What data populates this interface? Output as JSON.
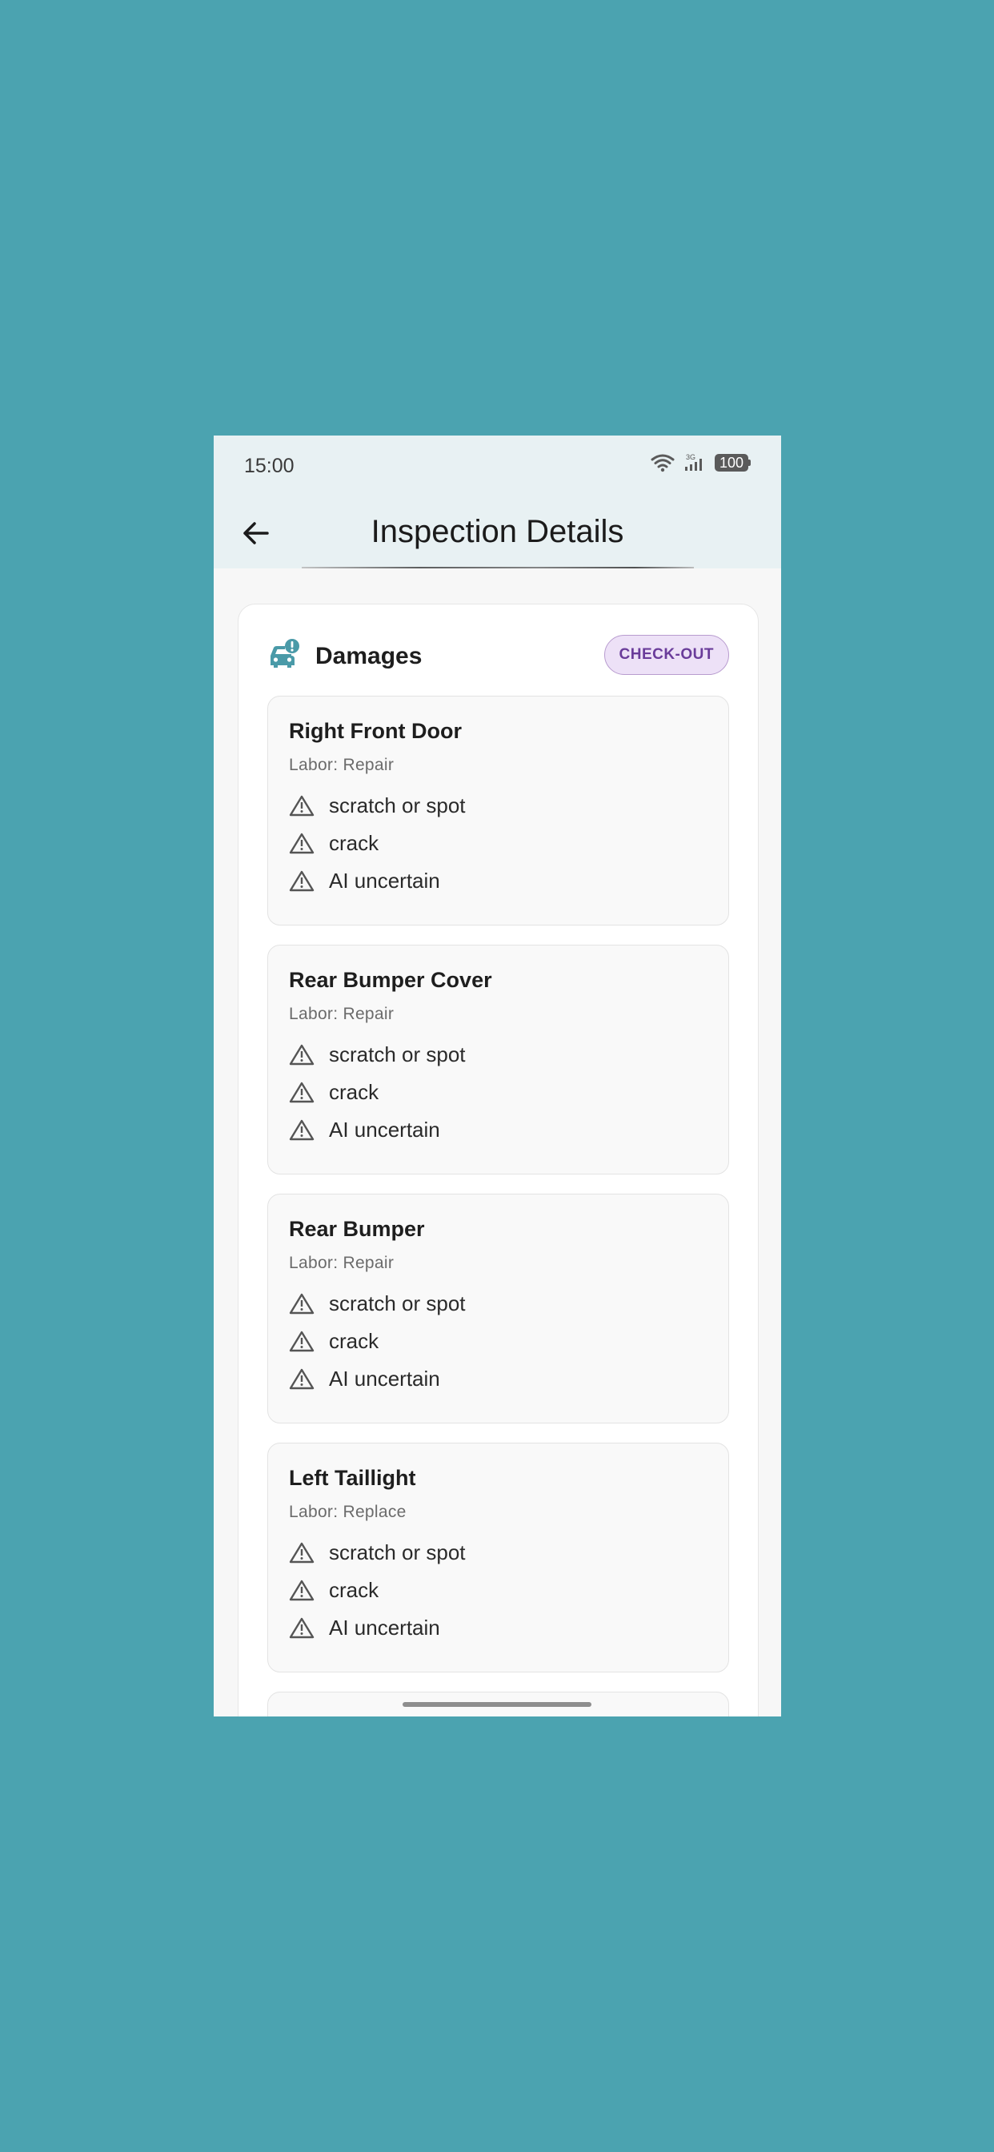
{
  "status_bar": {
    "time": "15:00",
    "network": "3G",
    "battery": "100"
  },
  "app_bar": {
    "title": "Inspection Details",
    "back_icon": "arrow-left-icon"
  },
  "damages_card": {
    "title": "Damages",
    "icon": "car-alert-icon",
    "badge": "CHECK-OUT",
    "items": [
      {
        "part": "Right Front Door",
        "labor": "Labor: Repair",
        "issues": [
          "scratch or spot",
          "crack",
          "AI uncertain"
        ]
      },
      {
        "part": "Rear Bumper Cover",
        "labor": "Labor: Repair",
        "issues": [
          "scratch or spot",
          "crack",
          "AI uncertain"
        ]
      },
      {
        "part": "Rear Bumper",
        "labor": "Labor: Repair",
        "issues": [
          "scratch or spot",
          "crack",
          "AI uncertain"
        ]
      },
      {
        "part": "Left Taillight",
        "labor": "Labor: Replace",
        "issues": [
          "scratch or spot",
          "crack",
          "AI uncertain"
        ]
      }
    ]
  },
  "colors": {
    "background": "#4ba3b0",
    "app_bar": "#e8f1f3",
    "icon_teal": "#4a9aa8",
    "badge_bg": "#ede1f7",
    "badge_text": "#6a3c9a"
  }
}
